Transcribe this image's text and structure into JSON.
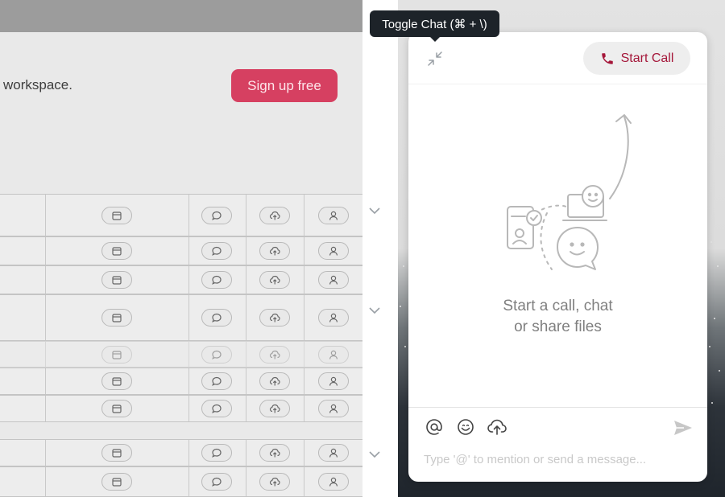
{
  "background_page": {
    "hero_text": "workspace.",
    "signup_button_label": "Sign up free",
    "row_icons": [
      "calendar-icon",
      "chat-bubble-icon",
      "upload-cloud-icon",
      "user-icon"
    ],
    "colors": {
      "signup": "#d64061",
      "overlay": "#e9e9e9"
    }
  },
  "tooltip": {
    "text": "Toggle Chat (⌘ + \\)"
  },
  "chat": {
    "start_call_label": "Start Call",
    "empty_state": {
      "line1": "Start a call, chat",
      "line2": "or share files"
    },
    "composer": {
      "placeholder": "Type '@' to mention or send a message...",
      "toolbar": [
        "mention-icon",
        "emoji-icon",
        "upload-icon"
      ],
      "send_icon": "send-icon"
    },
    "colors": {
      "accent": "#a5173a",
      "panel": "#ffffff",
      "button_bg": "#eeeeee"
    }
  }
}
